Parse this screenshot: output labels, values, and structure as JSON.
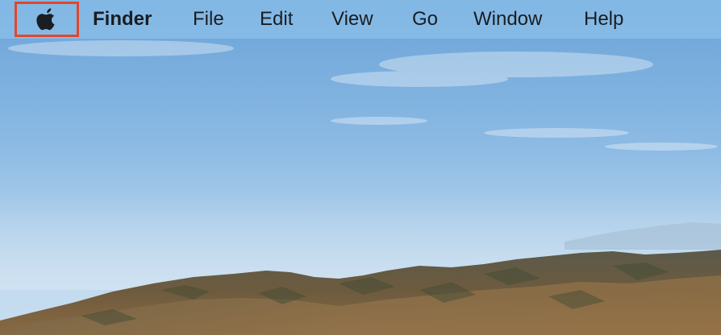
{
  "menubar": {
    "apple_icon": "apple-logo-icon",
    "app_name": "Finder",
    "items": [
      "File",
      "Edit",
      "View",
      "Go",
      "Window",
      "Help"
    ]
  },
  "colors": {
    "highlight_border": "#e0472d",
    "menu_text": "#1a1d21",
    "sky_top": "#6fa8dc",
    "sky_bottom": "#c3dbee"
  },
  "wallpaper": "Big Sur coastal mountain landscape"
}
